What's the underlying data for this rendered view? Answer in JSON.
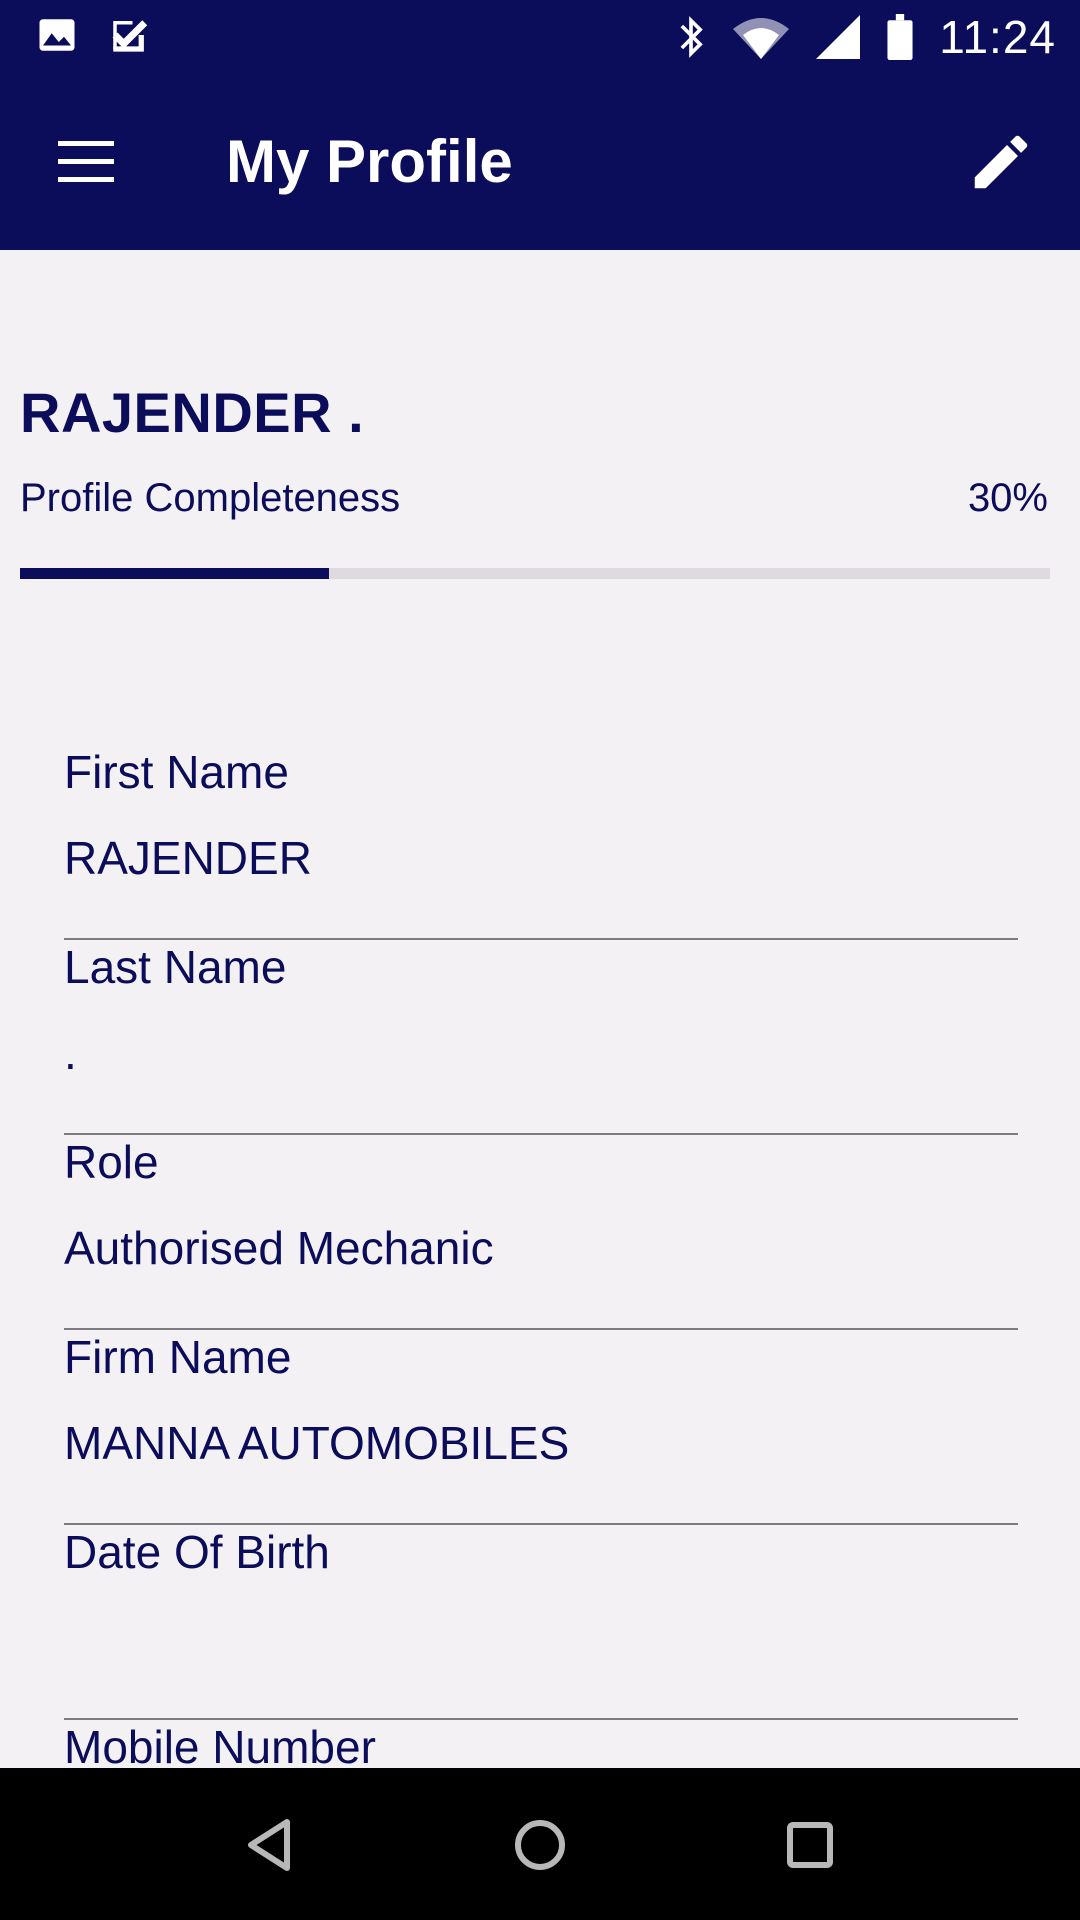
{
  "status_bar": {
    "time": "11:24",
    "left_icons": [
      "image-icon",
      "task-check-icon"
    ],
    "right_icons": [
      "bluetooth-icon",
      "wifi-icon",
      "signal-icon",
      "battery-icon"
    ]
  },
  "app_bar": {
    "title": "My Profile",
    "menu_icon": "menu-icon",
    "edit_icon": "edit-pencil-icon"
  },
  "profile": {
    "name": "RAJENDER .",
    "completeness_label": "Profile Completeness",
    "completeness_text": "30%",
    "completeness_fraction": 0.3
  },
  "fields": {
    "first_name": {
      "label": "First Name",
      "value": "RAJENDER"
    },
    "last_name": {
      "label": "Last Name",
      "value": "."
    },
    "role": {
      "label": "Role",
      "value": "Authorised Mechanic"
    },
    "firm_name": {
      "label": "Firm Name",
      "value": "MANNA AUTOMOBILES"
    },
    "dob": {
      "label": "Date Of Birth",
      "value": ""
    },
    "mobile": {
      "label": "Mobile Number",
      "value": ""
    }
  },
  "colors": {
    "primary": "#0b0c5a",
    "background": "#f4f1f5",
    "track": "#dedadf",
    "divider": "#7d7a80"
  },
  "nav_bar": {
    "icons": [
      "back-icon",
      "home-icon",
      "recents-icon"
    ]
  }
}
